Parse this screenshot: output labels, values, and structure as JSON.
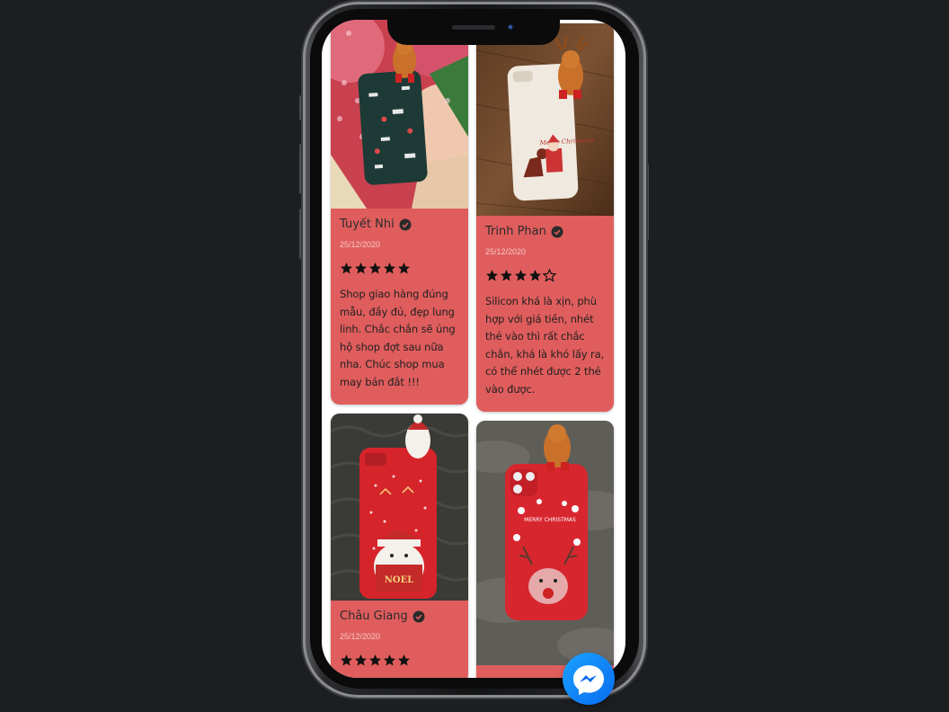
{
  "reviews": [
    {
      "name": "Tuyết Nhi",
      "date": "25/12/2020",
      "rating": 5,
      "text": "Shop giao hàng đúng mẫu, đầy đủ, đẹp lung linh. Chắc chắn sẽ ủng hộ shop đợt sau nữa nha. Chúc shop mua may bán đắt !!!"
    },
    {
      "name": "Trinh Phan",
      "date": "25/12/2020",
      "rating": 4,
      "text": "Silicon khá là xịn, phù hợp với giá tiền, nhét thẻ vào thì rất chắc chắn, khá là khó lấy ra, có thể nhét được 2 thẻ vào được."
    },
    {
      "name": "Châu Giang",
      "date": "25/12/2020",
      "rating": 5,
      "text": ""
    }
  ],
  "phone_case_prints": {
    "white_case": "Merry Christmas",
    "bear_sweater": "NOEL",
    "red_reindeer_case": "MERRY CHRISTMAS"
  },
  "colors": {
    "card_background": "#e05d5d",
    "page_background": "#1d1e20",
    "messenger_blue": "#0a6cf0"
  }
}
